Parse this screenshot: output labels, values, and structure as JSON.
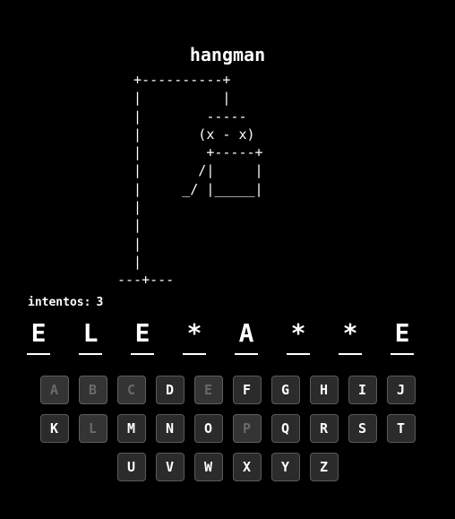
{
  "title": "hangman",
  "gallows_art": "  +----------+\n  |          |\n  |        -----\n  |       (x - x)\n  |        +-----+\n  |       /|     |\n  |     _/ |_____|\n  |\n  |\n  |\n  |\n---+---",
  "attempts": {
    "label": "intentos:",
    "value": "3"
  },
  "word_slots": [
    "E",
    "L",
    "E",
    "*",
    "A",
    "*",
    "*",
    "E"
  ],
  "keyboard": {
    "rows": [
      [
        {
          "letter": "A",
          "used": true
        },
        {
          "letter": "B",
          "used": true
        },
        {
          "letter": "C",
          "used": true
        },
        {
          "letter": "D",
          "used": false
        },
        {
          "letter": "E",
          "used": true
        },
        {
          "letter": "F",
          "used": false
        },
        {
          "letter": "G",
          "used": false
        },
        {
          "letter": "H",
          "used": false
        },
        {
          "letter": "I",
          "used": false
        },
        {
          "letter": "J",
          "used": false
        }
      ],
      [
        {
          "letter": "K",
          "used": false
        },
        {
          "letter": "L",
          "used": true
        },
        {
          "letter": "M",
          "used": false
        },
        {
          "letter": "N",
          "used": false
        },
        {
          "letter": "O",
          "used": false
        },
        {
          "letter": "P",
          "used": true
        },
        {
          "letter": "Q",
          "used": false
        },
        {
          "letter": "R",
          "used": false
        },
        {
          "letter": "S",
          "used": false
        },
        {
          "letter": "T",
          "used": false
        }
      ],
      [
        {
          "letter": "U",
          "used": false
        },
        {
          "letter": "V",
          "used": false
        },
        {
          "letter": "W",
          "used": false
        },
        {
          "letter": "X",
          "used": false
        },
        {
          "letter": "Y",
          "used": false
        },
        {
          "letter": "Z",
          "used": false
        }
      ]
    ]
  },
  "colors": {
    "background": "#000000",
    "text": "#ffffff",
    "key_bg": "#2b2b2b",
    "key_used_text": "#6a6a6a"
  }
}
